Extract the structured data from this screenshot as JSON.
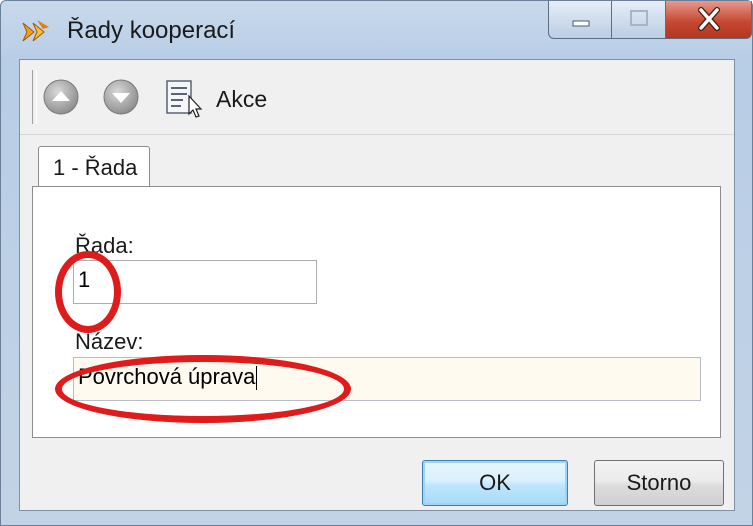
{
  "window": {
    "title": "Řady kooperací",
    "controls": [
      "minimize",
      "maximize",
      "close"
    ],
    "icon": "arrows-app-icon"
  },
  "toolbar": {
    "up_icon": "arrow-up-icon",
    "down_icon": "arrow-down-icon",
    "action_icon": "document-cursor-icon",
    "action_label": "Akce"
  },
  "tabs": [
    {
      "label": "1 - Řada",
      "selected": true
    }
  ],
  "form": {
    "rada_label": "Řada:",
    "rada_value": "1",
    "nazev_label": "Název:",
    "nazev_value": "Povrchová úprava"
  },
  "buttons": {
    "ok_label": "OK",
    "cancel_label": "Storno"
  },
  "colors": {
    "annotation": "#e01b1b",
    "close_button": "#c64a33",
    "default_button_border": "#3c7fb1"
  }
}
